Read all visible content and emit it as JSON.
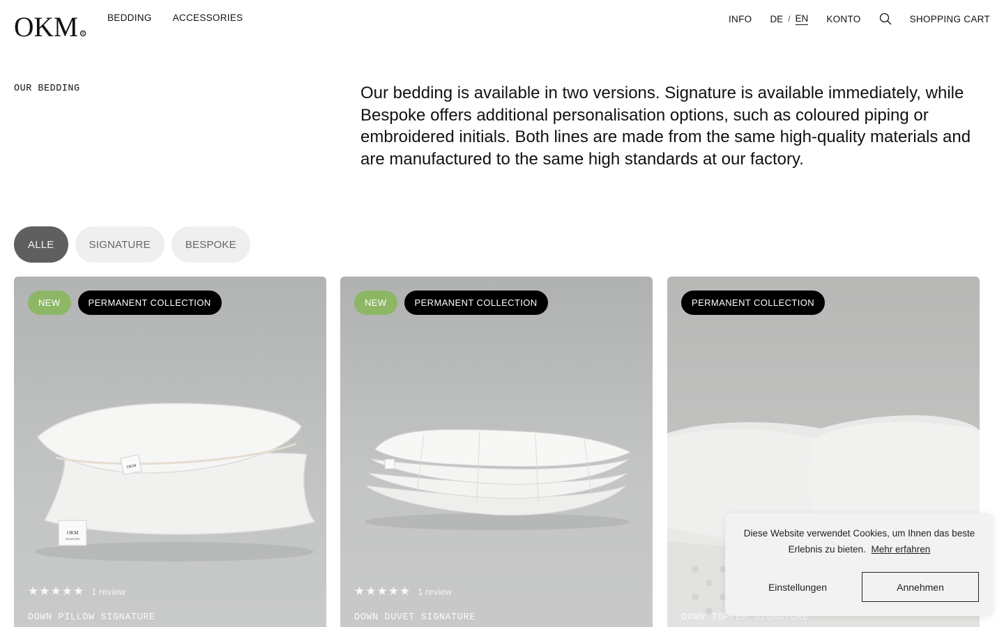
{
  "brand": {
    "name": "OKM"
  },
  "header": {
    "nav_left": [
      "BEDDING",
      "ACCESSORIES"
    ],
    "info": "INFO",
    "lang_de": "DE",
    "lang_sep": "/",
    "lang_en": "EN",
    "account": "KONTO",
    "cart": "SHOPPING CART"
  },
  "intro": {
    "label": "OUR BEDDING",
    "text": "Our bedding is available in two versions. Signature is available immediately, while Bespoke offers additional personalisation options, such as coloured piping or embroidered initials. Both lines are made from the same high-quality materials and are manufactured to the same high standards at our factory."
  },
  "filters": {
    "all": "ALLE",
    "signature": "SIGNATURE",
    "bespoke": "BESPOKE",
    "active": "ALLE"
  },
  "products": [
    {
      "badge_new": "NEW",
      "badge_collection": "PERMANENT COLLECTION",
      "stars": "★★★★★",
      "rating": 5,
      "reviews": "1 review",
      "title": "DOWN PILLOW SIGNATURE"
    },
    {
      "badge_new": "NEW",
      "badge_collection": "PERMANENT COLLECTION",
      "stars": "★★★★★",
      "rating": 5,
      "reviews": "1 review",
      "title": "DOWN DUVET SIGNATURE"
    },
    {
      "badge_collection": "PERMANENT COLLECTION",
      "title": "DOWN TOPPER SIGNATURE"
    }
  ],
  "cookie": {
    "text": "Diese Website verwendet Cookies, um Ihnen das beste Erlebnis zu bieten.",
    "link": "Mehr erfahren",
    "settings": "Einstellungen",
    "accept": "Annehmen"
  },
  "colors": {
    "badge_new": "#8db764",
    "badge_collection": "#000000",
    "filter_active": "#5f5f5f",
    "filter_inactive": "#efefef"
  },
  "icons": {
    "search": "search-icon",
    "brand": "okm-logo",
    "star": "star-icon"
  }
}
